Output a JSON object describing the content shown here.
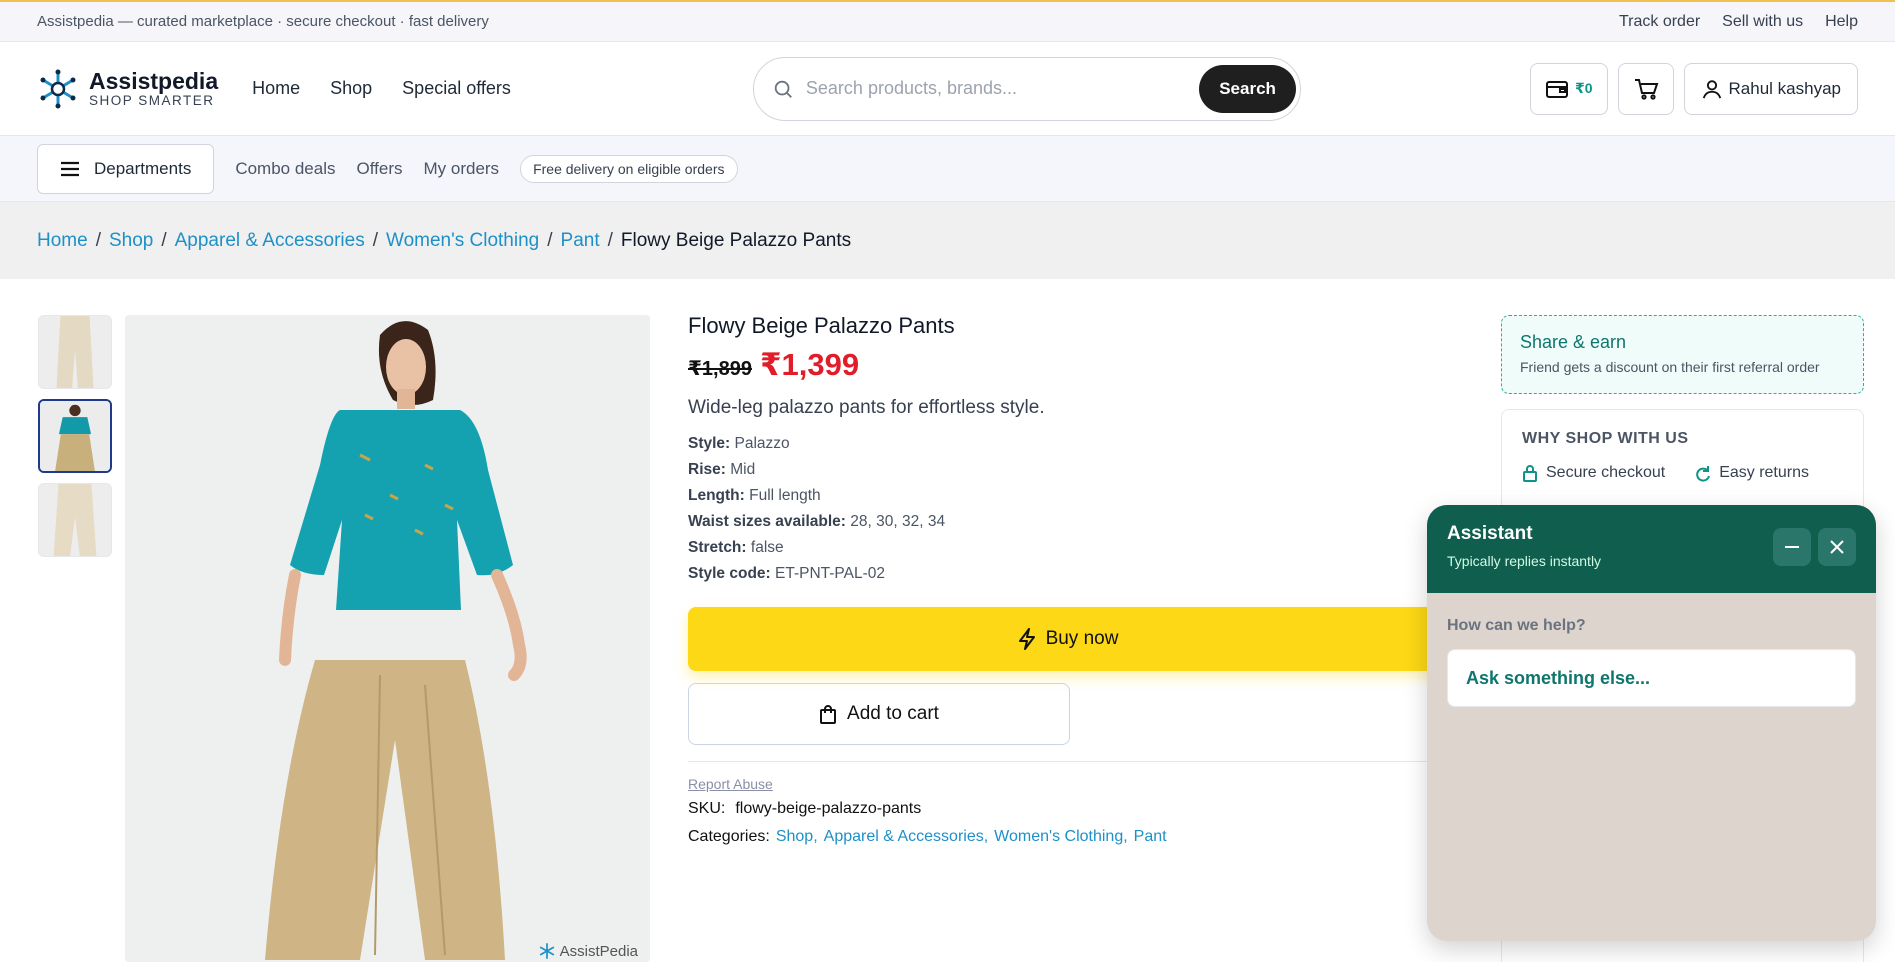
{
  "topbar": {
    "tagline": "Assistpedia — curated marketplace · secure checkout · fast delivery",
    "links": [
      "Track order",
      "Sell with us",
      "Help"
    ]
  },
  "header": {
    "brand": "Assistpedia",
    "brand_tagline": "SHOP SMARTER",
    "nav": [
      "Home",
      "Shop",
      "Special offers"
    ],
    "search_placeholder": "Search products, brands...",
    "search_button": "Search",
    "wallet": "₹0",
    "user": "Rahul kashyap"
  },
  "subnav": {
    "departments": "Departments",
    "links": [
      "Combo deals",
      "Offers",
      "My orders"
    ],
    "badge": "Free delivery on eligible orders"
  },
  "breadcrumb": {
    "links": [
      "Home",
      "Shop",
      "Apparel & Accessories",
      "Women's Clothing",
      "Pant"
    ],
    "current": "Flowy Beige Palazzo Pants"
  },
  "gallery": {
    "watermark": "AssistPedia"
  },
  "product": {
    "title": "Flowy Beige Palazzo Pants",
    "old_price": "₹1,899",
    "price": "₹1,399",
    "description": "Wide-leg palazzo pants for effortless style.",
    "specs": [
      {
        "label": "Style:",
        "value": "Palazzo"
      },
      {
        "label": "Rise:",
        "value": "Mid"
      },
      {
        "label": "Length:",
        "value": "Full length"
      },
      {
        "label": "Waist sizes available:",
        "value": "28, 30, 32, 34"
      },
      {
        "label": "Stretch:",
        "value": "false"
      },
      {
        "label": "Style code:",
        "value": "ET-PNT-PAL-02"
      }
    ],
    "buy_now": "Buy now",
    "add_to_cart": "Add to cart",
    "report": "Report Abuse",
    "sku_label": "SKU:",
    "sku": "flowy-beige-palazzo-pants",
    "categories_label": "Categories:",
    "categories": [
      "Shop,",
      "Apparel & Accessories,",
      "Women's Clothing,",
      "Pant"
    ]
  },
  "sidebar": {
    "share_title": "Share & earn",
    "share_sub": "Friend gets a discount on their first referral order",
    "why_title": "WHY SHOP WITH US",
    "why_items": [
      "Secure checkout",
      "Easy returns"
    ]
  },
  "assistant": {
    "title": "Assistant",
    "subtitle": "Typically replies instantly",
    "prompt": "How can we help?",
    "input": "Ask something else..."
  },
  "colors": {
    "accent_teal": "#0f5e4e",
    "price_red": "#e11d2a",
    "buy_yellow": "#fcd816",
    "link_blue": "#1e90c8"
  }
}
